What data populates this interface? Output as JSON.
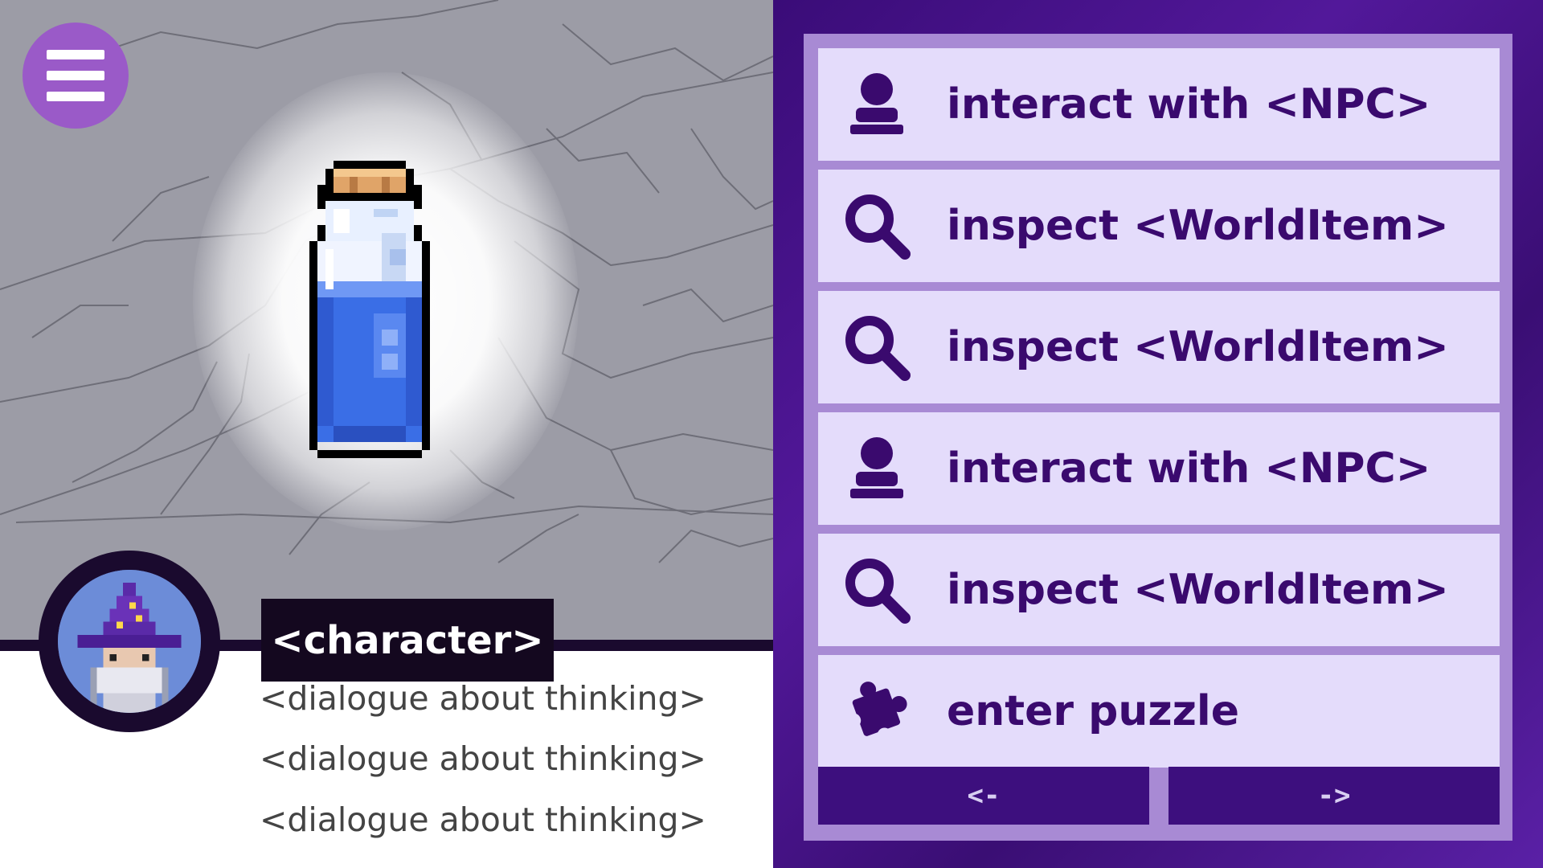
{
  "menu": {
    "icon": "hamburger-menu-icon"
  },
  "scene": {
    "item_icon": "potion-bottle-icon"
  },
  "dialogue": {
    "character_name": "<character>",
    "lines": [
      "<dialogue about thinking>",
      "<dialogue about thinking>",
      "<dialogue about thinking>"
    ],
    "portrait_icon": "wizard-portrait-icon"
  },
  "actions": [
    {
      "label": "interact with <NPC>",
      "icon": "person-icon"
    },
    {
      "label": "inspect <WorldItem>",
      "icon": "magnifier-icon"
    },
    {
      "label": "inspect <WorldItem>",
      "icon": "magnifier-icon"
    },
    {
      "label": "interact with <NPC>",
      "icon": "person-icon"
    },
    {
      "label": "inspect <WorldItem>",
      "icon": "magnifier-icon"
    },
    {
      "label": "enter puzzle",
      "icon": "puzzle-piece-icon"
    }
  ],
  "nav": {
    "prev_label": "<-",
    "next_label": "->"
  },
  "colors": {
    "panel_purple": "#3d0f7e",
    "button_fill": "#e4dcfb",
    "label_text": "#3a0a6e",
    "menu_button": "#9a5ac8"
  }
}
